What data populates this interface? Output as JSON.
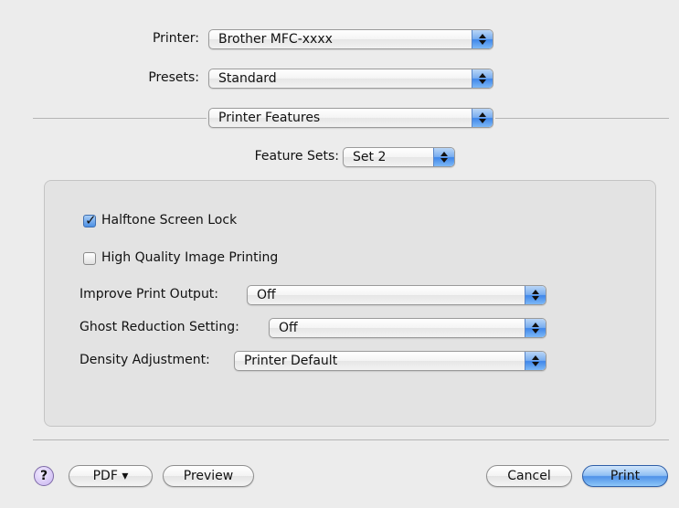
{
  "printer": {
    "label": "Printer:",
    "value": "Brother MFC-xxxx"
  },
  "presets": {
    "label": "Presets:",
    "value": "Standard"
  },
  "panel_menu": {
    "value": "Printer Features"
  },
  "feature_sets": {
    "label": "Feature Sets:",
    "value": "Set 2"
  },
  "options": {
    "halftone": {
      "label": "Halftone Screen Lock",
      "checked": true
    },
    "high_quality": {
      "label": "High Quality Image Printing",
      "checked": false
    },
    "improve_output": {
      "label": "Improve Print Output:",
      "value": "Off"
    },
    "ghost_reduction": {
      "label": "Ghost Reduction Setting:",
      "value": "Off"
    },
    "density": {
      "label": "Density Adjustment:",
      "value": "Printer Default"
    }
  },
  "footer": {
    "help": "?",
    "pdf": "PDF ▾",
    "preview": "Preview",
    "cancel": "Cancel",
    "print": "Print"
  }
}
